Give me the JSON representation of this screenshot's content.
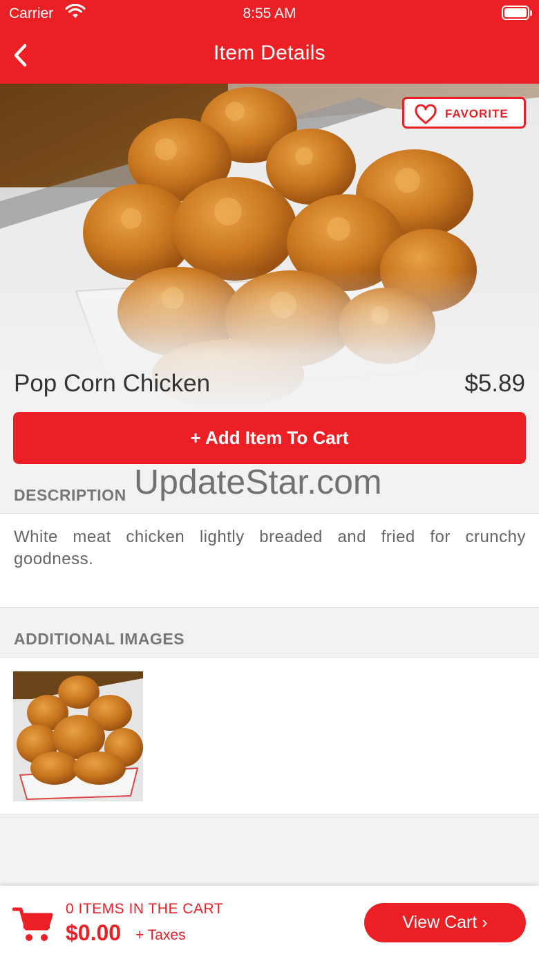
{
  "status_bar": {
    "carrier": "Carrier",
    "time": "8:55 AM"
  },
  "nav": {
    "title": "Item Details"
  },
  "item": {
    "favorite_label": "FAVORITE",
    "name": "Pop Corn Chicken",
    "price": "$5.89",
    "add_to_cart_label": "+ Add Item To Cart",
    "description_heading": "DESCRIPTION",
    "description": "White meat chicken lightly breaded and fried for crunchy goodness.",
    "additional_images_heading": "ADDITIONAL IMAGES"
  },
  "watermark": "UpdateStar.com",
  "cart": {
    "count_label": "0 ITEMS IN THE CART",
    "total": "$0.00",
    "taxes_label": "+ Taxes",
    "view_cart_label": "View Cart ›"
  },
  "colors": {
    "accent": "#ec2024",
    "background": "#f2f2f2"
  },
  "icons": [
    "wifi-icon",
    "battery-icon",
    "back-chevron-icon",
    "heart-icon",
    "shopping-cart-icon"
  ]
}
